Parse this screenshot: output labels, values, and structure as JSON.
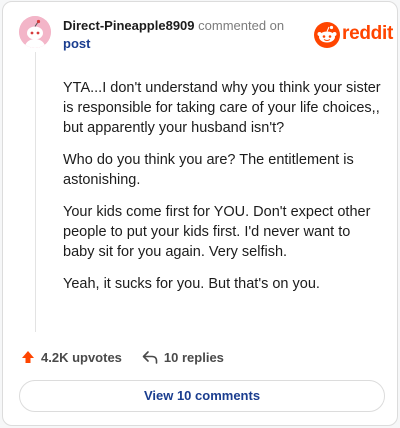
{
  "comment": {
    "author": "Direct-Pineapple8909",
    "action_text": "commented on",
    "target_link": "post",
    "paragraphs": [
      "YTA...I don't understand why you think your sister is responsible for taking care of your life choices,, but apparently your husband isn't?",
      "Who do you think you are? The entitlement is astonishing.",
      "Your kids come first for YOU. Don't expect other people to put your kids first. I'd never want to baby sit for you again. Very selfish.",
      "Yeah, it sucks for you. But that's on you."
    ]
  },
  "brand": {
    "wordmark": "reddit",
    "color": "#ff4500"
  },
  "stats": {
    "upvotes": "4.2K upvotes",
    "replies": "10 replies"
  },
  "view_comments_label": "View 10 comments",
  "icons": {
    "avatar": "snoo-avatar-icon",
    "logo": "reddit-logo-icon",
    "upvote": "upvote-arrow-icon",
    "reply": "reply-arrow-icon"
  }
}
